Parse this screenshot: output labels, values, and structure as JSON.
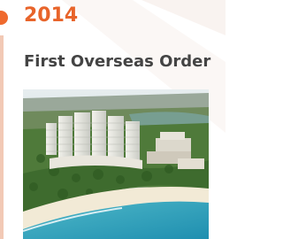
{
  "milestone": {
    "year": "2014",
    "title": "First Overseas Order"
  },
  "photo": {
    "subject": "coastal-resort-aerial-photo"
  },
  "colors": {
    "accent": "#ef6a2e",
    "year_text": "#e8642a",
    "timeline_line": "#f2c9b5",
    "title_text": "#444444"
  }
}
